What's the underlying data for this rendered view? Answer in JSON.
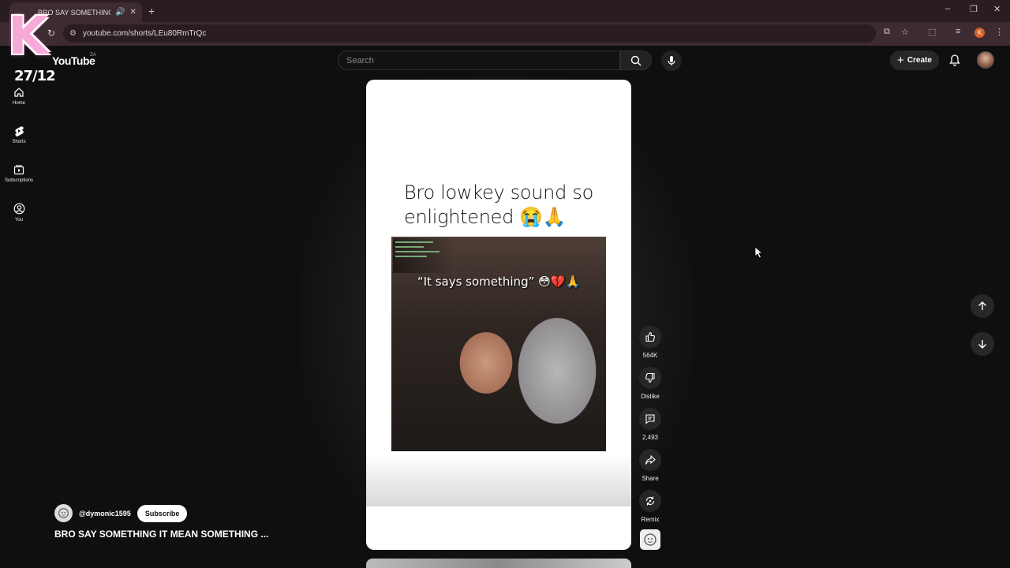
{
  "browser": {
    "tab_title": "BRO SAY SOMETHING IT MEAN SOMETHING",
    "new_tab": "+",
    "url": "youtube.com/shorts/LEu80RmTrQc",
    "profile_letter": "K"
  },
  "overlay": {
    "sticker_letter": "K",
    "date": "27/12"
  },
  "header": {
    "logo": "YouTube",
    "region": "ZA",
    "search_placeholder": "Search",
    "create_label": "Create"
  },
  "sidebar": {
    "items": [
      {
        "label": "Home",
        "icon": "home-icon"
      },
      {
        "label": "Shorts",
        "icon": "shorts-icon"
      },
      {
        "label": "Subscriptions",
        "icon": "subscriptions-icon"
      },
      {
        "label": "You",
        "icon": "you-icon"
      }
    ]
  },
  "short": {
    "caption": "Bro lowkey sound so enlightened 😭🙏",
    "overlay_text": "“It says something” 😳💔🙏"
  },
  "actions": {
    "like_count": "564K",
    "dislike_label": "Dislike",
    "comment_count": "2,493",
    "share_label": "Share",
    "remix_label": "Remix"
  },
  "channel": {
    "handle": "@dymonic1595",
    "subscribe_label": "Subscribe",
    "video_title": "BRO SAY SOMETHING IT MEAN SOMETHING ..."
  },
  "colors": {
    "background": "#0f0f0f",
    "browser_chrome": "#2a1d22",
    "sticker_pink": "#f7a9d8"
  }
}
